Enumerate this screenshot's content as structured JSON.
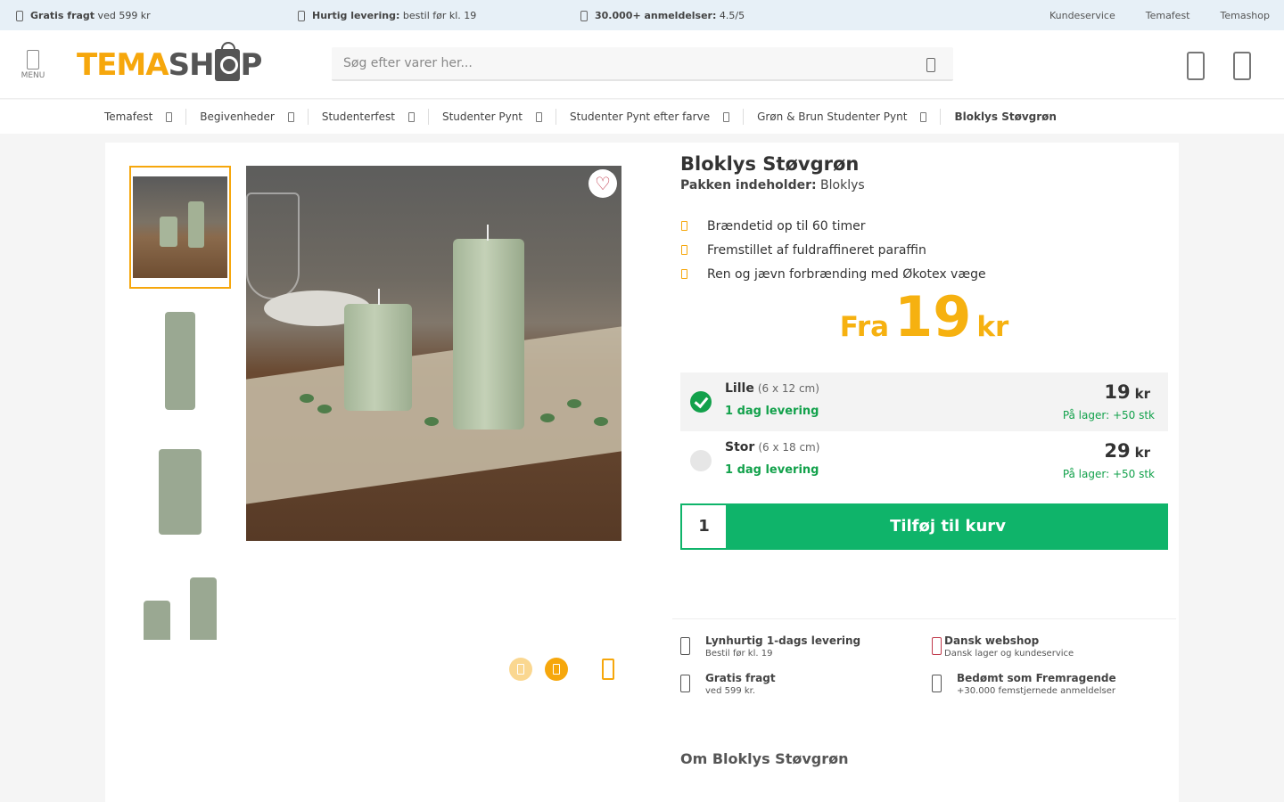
{
  "topbar": {
    "usps": [
      {
        "bold": "Gratis fragt",
        "text": " ved 599 kr",
        "icon": "truck-icon"
      },
      {
        "bold": "Hurtig levering:",
        "text": " bestil før kl. 19",
        "icon": "clock-icon"
      },
      {
        "bold": "30.000+ anmeldelser:",
        "text": " 4.5/5",
        "icon": "star-icon"
      }
    ],
    "links": [
      "Kundeservice",
      "Temafest",
      "Temashop"
    ]
  },
  "header": {
    "menu_label": "MENU",
    "logo_part1": "TEMA",
    "logo_part2": "SH",
    "logo_part3": "P",
    "search_placeholder": "Søg efter varer her..."
  },
  "breadcrumb": [
    "Temafest",
    "Begivenheder",
    "Studenterfest",
    "Studenter Pynt",
    "Studenter Pynt efter farve",
    "Grøn & Brun Studenter Pynt",
    "Bloklys Støvgrøn"
  ],
  "product": {
    "title": "Bloklys Støvgrøn",
    "pack_label": "Pakken indeholder:",
    "pack_value": " Bloklys",
    "features": [
      "Brændetid op til 60 timer",
      "Fremstillet af fuldraffineret paraffin",
      "Ren og jævn forbrænding med Økotex væge"
    ],
    "price_prefix": "Fra",
    "price_value": "19",
    "price_currency": "kr",
    "variants": [
      {
        "name": "Lille",
        "size": "(6 x 12 cm)",
        "delivery": "1 dag levering",
        "price": "19",
        "currency": "kr",
        "stock": "På lager: +50 stk",
        "selected": true
      },
      {
        "name": "Stor",
        "size": "(6 x 18 cm)",
        "delivery": "1 dag levering",
        "price": "29",
        "currency": "kr",
        "stock": "På lager: +50 stk",
        "selected": false
      }
    ],
    "quantity": "1",
    "add_to_cart": "Tilføj til kurv"
  },
  "trust": [
    {
      "title": "Lynhurtig 1-dags levering",
      "sub": "Bestil før kl. 19",
      "icon": "truck-icon"
    },
    {
      "title": "Dansk webshop",
      "sub": "Dansk lager og kundeservice",
      "icon": "danish-flag-icon"
    },
    {
      "title": "Gratis fragt",
      "sub": "ved 599 kr.",
      "icon": "package-icon"
    },
    {
      "title": "Bedømt som Fremragende",
      "sub": "+30.000 femstjernede anmeldelser",
      "icon": "star-icon"
    }
  ],
  "about_title": "Om Bloklys Støvgrøn",
  "colors": {
    "accent": "#f6a70c",
    "price": "#f6b110",
    "green": "#0fb46a",
    "topbar": "#e7f0f7"
  }
}
